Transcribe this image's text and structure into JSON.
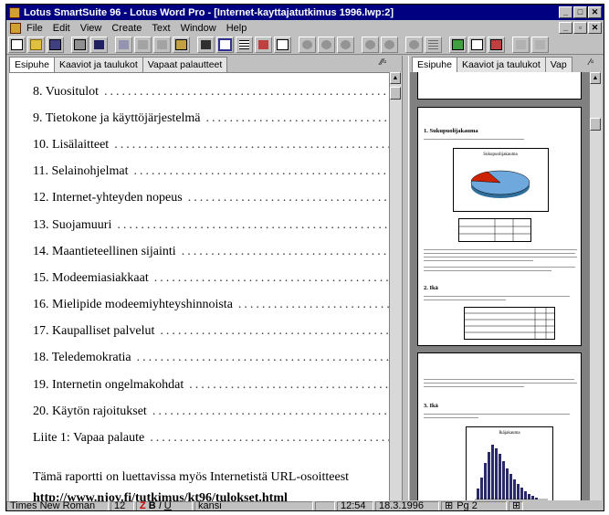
{
  "window": {
    "title": "Lotus SmartSuite 96 - Lotus Word Pro - [Internet-kayttajatutkimus 1996.lwp:2]"
  },
  "menu": {
    "items": [
      "File",
      "Edit",
      "View",
      "Create",
      "Text",
      "Window",
      "Help"
    ]
  },
  "toolbar": {
    "icons": [
      "new-document-icon",
      "open-folder-icon",
      "save-icon",
      "print-icon",
      "print-preview-icon",
      "undo-icon",
      "cut-icon",
      "copy-icon",
      "paste-icon",
      "bold-format-icon",
      "frame-icon",
      "table-icon",
      "chart-icon",
      "cursor-icon",
      "draw-icon",
      "spell-check-icon",
      "thesaurus-icon",
      "bookmark-icon",
      "zoom-in-icon",
      "zoom-out-icon",
      "bullets-icon",
      "image-icon",
      "smartmaster-icon",
      "style-icon",
      "inactive-icon",
      "navigate-icon"
    ]
  },
  "tabs_left": [
    "Esipuhe",
    "Kaaviot ja taulukot",
    "Vapaat palautteet"
  ],
  "tabs_right": [
    "Esipuhe",
    "Kaaviot ja taulukot",
    "Vap"
  ],
  "toc": [
    "8. Vuositulot",
    "9. Tietokone ja käyttöjärjestelmä",
    "10. Lisälaitteet",
    "11. Selainohjelmat",
    "12. Internet-yhteyden nopeus",
    "13. Suojamuuri",
    "14. Maantieteellinen sijainti",
    "15. Modeemiasiakkaat",
    "16. Mielipide modeemiyhteyshinnoista",
    "17. Kaupalliset palvelut",
    "18. Teledemokratia",
    "19. Internetin ongelmakohdat",
    "20. Käytön rajoitukset",
    "Liite 1: Vapaa palaute"
  ],
  "body": {
    "paragraph": "Tämä raportti on luettavissa myös Internetistä URL-osoitteest",
    "url": "http://www.njov.fi/tutkimus/kt96/tulokset.html"
  },
  "preview": {
    "page1": {
      "heading1": "1. Sukupuolijakauma",
      "heading2": "2. Ikä",
      "chart_title": "Sukupuolijakauma"
    },
    "page2": {
      "heading": "3. Ikä",
      "chart_title": "Ikäjakauma"
    }
  },
  "status": {
    "font": "Times New Roman",
    "size": "12",
    "style": "kansi",
    "time": "12:54",
    "date": "18.3.1996",
    "page": "Pg 2"
  },
  "colors": {
    "titlebar": "#000080",
    "chrome": "#c0c0c0",
    "pie_main": "#6fa8dc",
    "pie_slice": "#cc2200"
  }
}
